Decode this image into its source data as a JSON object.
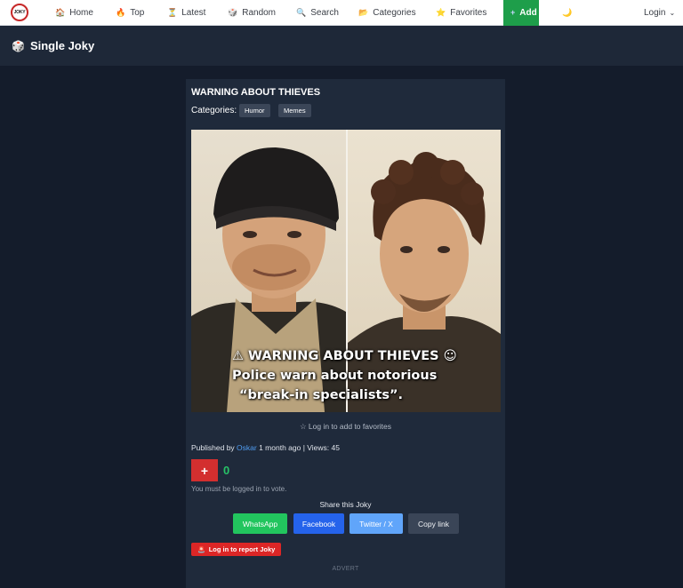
{
  "navbar": {
    "logo_text": "JOKY",
    "items": [
      {
        "label": "Home",
        "icon": "house-icon",
        "glyph": "🏠"
      },
      {
        "label": "Top",
        "icon": "fire-icon",
        "glyph": "🔥"
      },
      {
        "label": "Latest",
        "icon": "hourglass-icon",
        "glyph": "⏳"
      },
      {
        "label": "Random",
        "icon": "dice-icon",
        "glyph": "🎲"
      },
      {
        "label": "Search",
        "icon": "search-icon",
        "glyph": "🔍"
      },
      {
        "label": "Categories",
        "icon": "folder-icon",
        "glyph": "📂"
      },
      {
        "label": "Favorites",
        "icon": "star-icon",
        "glyph": "⭐"
      }
    ],
    "add": {
      "label": "Add",
      "icon": "plus-icon",
      "glyph": "+"
    },
    "theme_toggle": {
      "icon": "moon-icon",
      "glyph": "🌙"
    },
    "login": {
      "label": "Login",
      "chevron": "⌄"
    }
  },
  "page": {
    "title": "Single Joky",
    "title_icon": "🎲"
  },
  "joke": {
    "title": "WARNING ABOUT THIEVES",
    "categories_label": "Categories:",
    "categories": [
      "Humor",
      "Memes"
    ],
    "image": {
      "caption_line1": "⚠ WARNING ABOUT THIEVES ☺",
      "caption_line2": "Police warn about notorious",
      "caption_line3": "“break-in specialists”."
    },
    "favorites_text": "☆ Log in to add to favorites",
    "published_prefix": "Published by",
    "author": "Oskar",
    "published_suffix": "1 month ago | Views: 45",
    "vote_label": "+",
    "vote_count": "0",
    "vote_note": "You must be logged in to vote.",
    "share_title": "Share this Joky",
    "share_buttons": {
      "whatsapp": "WhatsApp",
      "facebook": "Facebook",
      "twitter": "Twitter / X",
      "copy": "Copy link"
    },
    "report_label": "Log in to report Joky",
    "report_icon": "🚨",
    "advert": "ADVERT"
  },
  "colors": {
    "accent_green": "#1e9e4a",
    "vote_red": "#d32f2f",
    "count_green": "#27c267",
    "link_blue": "#4f9cf0",
    "background": "#141c2b",
    "card": "#1f2a3b"
  }
}
